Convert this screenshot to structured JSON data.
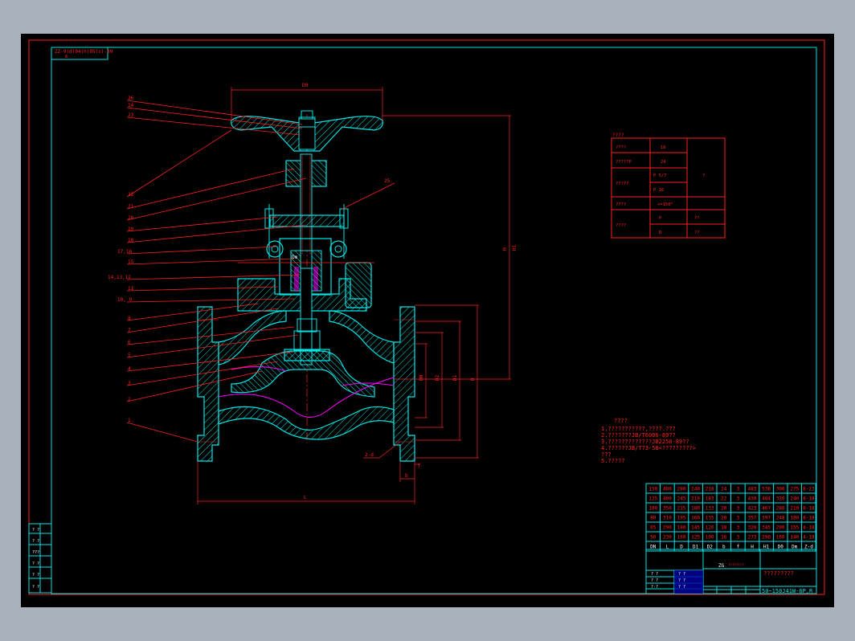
{
  "title_block": {
    "drawing_code": "ZZ-ESMvalves-89",
    "corner_label": "ZZ-9(d)04(h)05(c)-89",
    "corner_sub": "8",
    "part_name": "?????????",
    "model": "50~150J41W-6P,R",
    "company_logo_text": "ZG",
    "stamp_rows": [
      "? ?",
      "? ?",
      "? ?"
    ]
  },
  "callouts": [
    "26",
    "24",
    "23",
    "22",
    "21",
    "20",
    "19",
    "18",
    "17,16",
    "15",
    "14,13,12",
    "11",
    "10, 9",
    "8",
    "7",
    "6",
    "5",
    "4",
    "3",
    "2",
    "1",
    "25"
  ],
  "dimensions": {
    "D0": "D0",
    "H": "H",
    "H1": "H1",
    "Dm": "Dm",
    "L": "L",
    "b": "b",
    "f": "f",
    "Dn": "DN",
    "D2": "D2",
    "D1": "D1",
    "D": "D",
    "holes": "2-d"
  },
  "spec_table": {
    "header": "????",
    "rows": [
      [
        "????",
        "16",
        ""
      ],
      [
        "?????P",
        "24",
        ""
      ],
      [
        "?????",
        "P  5/7",
        "?"
      ],
      [
        "",
        "P  16",
        ""
      ],
      [
        "????",
        "<=150°",
        ""
      ],
      [
        "????",
        "P",
        "??"
      ],
      [
        "",
        "R",
        "??"
      ]
    ]
  },
  "notes": {
    "title": "????",
    "lines": [
      "1.???????????,????.???",
      "2.???????JB/T6006-89??",
      "3.?????????????JB2250-89??",
      "4.??????JB/T73-58<?????????>",
      "   ???",
      "5.?????"
    ]
  },
  "dim_table": {
    "rows": [
      [
        "150",
        "480",
        "280",
        "240",
        "218",
        "24",
        "3",
        "483",
        "538",
        "300",
        "275",
        "8-23"
      ],
      [
        "125",
        "400",
        "245",
        "210",
        "183",
        "22",
        "3",
        "430",
        "484",
        "320",
        "240",
        "8-18"
      ],
      [
        "100",
        "350",
        "215",
        "180",
        "133",
        "20",
        "3",
        "423",
        "467",
        "280",
        "210",
        "8-18"
      ],
      [
        "80",
        "310",
        "195",
        "160",
        "135",
        "20",
        "3",
        "357",
        "397",
        "248",
        "180",
        "8-18"
      ],
      [
        "65",
        "290",
        "180",
        "145",
        "120",
        "18",
        "3",
        "320",
        "345",
        "200",
        "155",
        "4-18"
      ],
      [
        "50",
        "230",
        "160",
        "125",
        "100",
        "16",
        "3",
        "273",
        "296",
        "160",
        "140",
        "4-18"
      ]
    ],
    "header": [
      "DN",
      "L",
      "D",
      "D1",
      "D2",
      "b",
      "f",
      "H",
      "H1",
      "D0",
      "Dm",
      "Z-d"
    ]
  },
  "revision_block": {
    "rows": [
      "? ?",
      "? ?",
      "?·?",
      "? ?",
      "? ?",
      "? ?"
    ]
  },
  "colors": {
    "frame": "#00e5e5",
    "outline": "#00e5e5",
    "leader": "#ff2020",
    "section": "#ff00ff",
    "paper": "#000000",
    "hatch": "#00e5e5"
  }
}
